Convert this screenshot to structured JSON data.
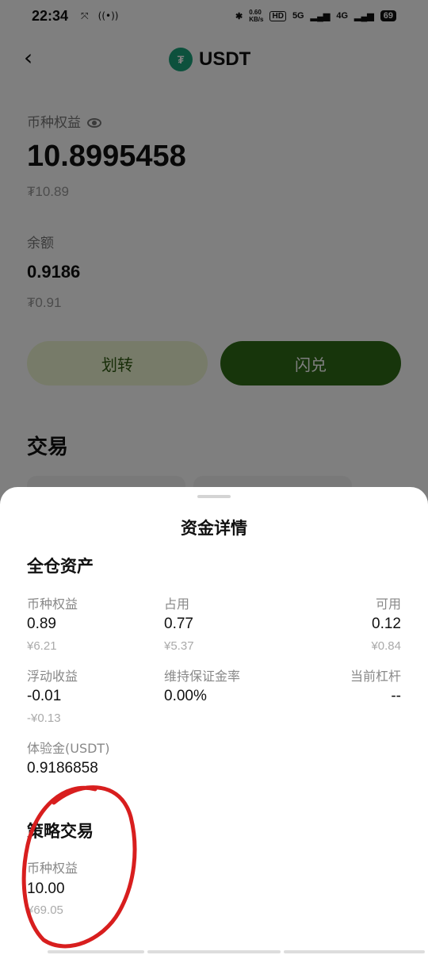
{
  "status": {
    "time": "22:34",
    "network_speed": "0.60\nKB/s",
    "hd": "HD",
    "sig5g": "5G",
    "sig4g": "4G",
    "battery": "69"
  },
  "nav": {
    "title": "USDT",
    "coin_symbol": "₮",
    "back_icon": "chevron-left-icon"
  },
  "equity": {
    "label": "币种权益",
    "value": "10.8995458",
    "fiat": "₮10.89"
  },
  "balance": {
    "label": "余额",
    "value": "0.9186",
    "fiat": "₮0.91"
  },
  "buttons": {
    "transfer": "划转",
    "flash": "闪兑"
  },
  "trade_heading": "交易",
  "sheet": {
    "title": "资金详情",
    "cross": {
      "heading": "全仓资产",
      "equity": {
        "label": "币种权益",
        "value": "0.89",
        "fiat": "¥6.21"
      },
      "used": {
        "label": "占用",
        "value": "0.77",
        "fiat": "¥5.37"
      },
      "available": {
        "label": "可用",
        "value": "0.12",
        "fiat": "¥0.84"
      },
      "floating": {
        "label": "浮动收益",
        "value": "-0.01",
        "fiat": "-¥0.13"
      },
      "margin_rate": {
        "label": "维持保证金率",
        "value": "0.00%"
      },
      "leverage": {
        "label": "当前杠杆",
        "value": "--"
      },
      "trial": {
        "label": "体验金(USDT)",
        "value": "0.9186858"
      }
    },
    "strategy": {
      "heading": "策略交易",
      "equity": {
        "label": "币种权益",
        "value": "10.00",
        "fiat": "¥69.05"
      }
    }
  },
  "colors": {
    "accent": "#2e6a17",
    "accent_light": "#eef6d3",
    "annotation": "#d81e1e",
    "tether": "#1ba27a"
  }
}
